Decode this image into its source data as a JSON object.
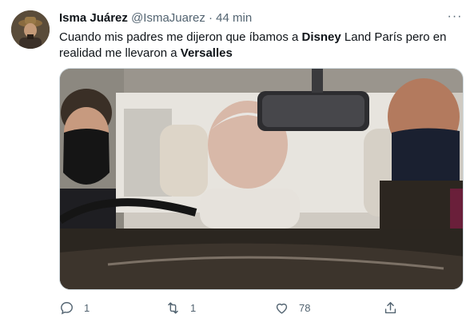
{
  "tweet": {
    "display_name": "Isma Juárez",
    "handle": "@IsmaJuarez",
    "separator": "·",
    "time": "44 min",
    "text_parts": {
      "p1": "Cuando mis padres me dijeron que íbamos a ",
      "b1": "Disney",
      "p2": " Land París pero en realidad me llevaron a ",
      "b2": "Versalles"
    },
    "more_label": "···"
  },
  "actions": {
    "reply_count": "1",
    "retweet_count": "1",
    "like_count": "78",
    "reply_icon": "reply-icon",
    "retweet_icon": "retweet-icon",
    "like_icon": "heart-icon",
    "share_icon": "share-icon"
  },
  "colors": {
    "text": "#0f1419",
    "secondary": "#536471",
    "border": "#cfd9de"
  }
}
